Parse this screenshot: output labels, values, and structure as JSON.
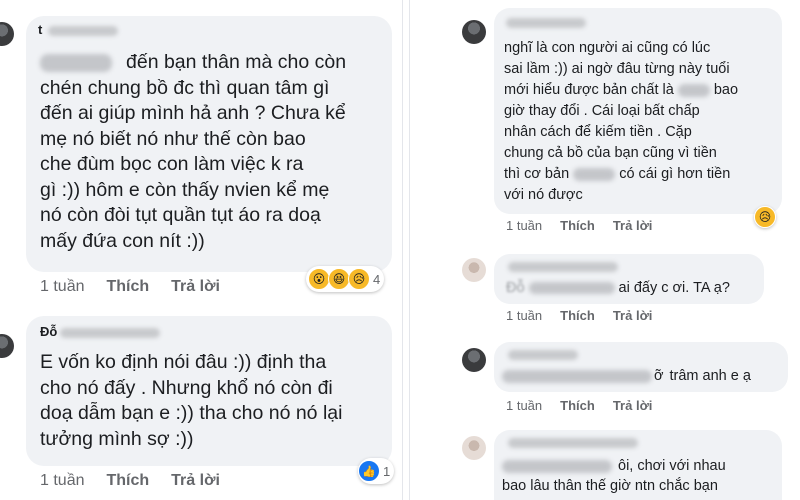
{
  "left": {
    "comments": [
      {
        "name": "t",
        "text_line1": "đến bạn thân mà cho còn",
        "text_rest": "chén chung bồ đc thì quan tâm gì\nđến ai giúp mình hả anh ? Chưa kể\nmẹ nó biết nó như thế còn bao\nche đùm bọc con làm việc k ra\ngì :)) hôm e còn thấy nvien kể mẹ\nnó còn đòi tụt quần tụt áo ra doạ\nmấy đứa con nít :))",
        "time": "1 tuần",
        "like": "Thích",
        "reply": "Trả lời",
        "reaction_count": "4"
      },
      {
        "name": "Đỗ",
        "text": "E vốn ko định nói đâu :)) định tha\ncho nó đấy . Nhưng khổ nó còn đi\ndoạ dẫm bạn e :)) tha cho nó nó lại\ntưởng mình sợ :))",
        "time": "1 tuần",
        "like": "Thích",
        "reply": "Trả lời",
        "reaction_count": "1"
      }
    ]
  },
  "right": {
    "comments": [
      {
        "line1": "nghĩ là con người ai cũng có lúc",
        "line2": "sai lầm :)) ai ngờ đâu từng này tuổi",
        "line3a": "mới hiểu được bản chất là",
        "line3b": "bao",
        "line4": "giờ thay đổi . Cái loại bất chấp",
        "line5": "nhân cách để kiếm tiền . Cặp",
        "line6": "chung cả bồ của bạn cũng vì tiền",
        "line7a": "thì cơ bản",
        "line7b": "có cái gì hơn tiền",
        "line8": "với nó được",
        "time": "1 tuần",
        "like": "Thích",
        "reply": "Trả lời"
      },
      {
        "text_prefix": "Đỗ",
        "text": "ai đấy c ơi. TA ạ?",
        "time": "1 tuần",
        "like": "Thích",
        "reply": "Trả lời"
      },
      {
        "text_suffix_blur": "ỡ",
        "text": "trâm anh e ạ",
        "time": "1 tuần",
        "like": "Thích",
        "reply": "Trả lời"
      },
      {
        "line1": "ôi, chơi với nhau",
        "line2": "bao lâu thân thế giờ ntn chắc bạn"
      }
    ]
  }
}
